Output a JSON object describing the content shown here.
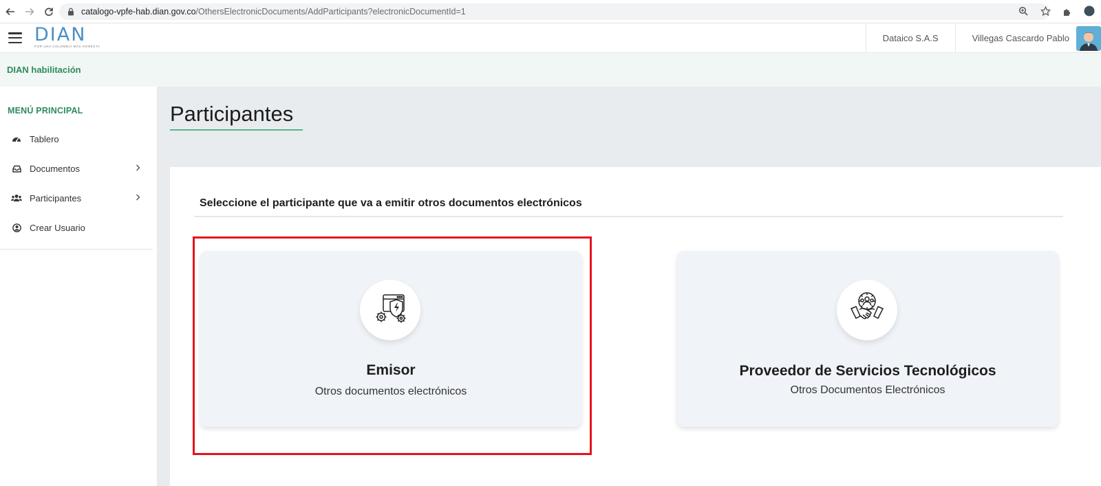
{
  "browser": {
    "url_host": "catalogo-vpfe-hab.dian.gov.co",
    "url_path": "/OthersElectronicDocuments/AddParticipants?electronicDocumentId=1",
    "icons": [
      "back-arrow-icon",
      "forward-arrow-icon",
      "reload-icon",
      "lock-icon",
      "zoom-icon",
      "star-icon",
      "extensions-icon"
    ]
  },
  "header": {
    "logo_text": "DIAN",
    "logo_tagline": "POR UNA COLOMBIA MÁS HONESTA",
    "company": "Dataico S.A.S",
    "user": "Villegas Cascardo Pablo"
  },
  "env": {
    "title": "DIAN habilitación"
  },
  "sidebar": {
    "title": "MENÚ PRINCIPAL",
    "items": [
      {
        "label": "Tablero",
        "icon": "dashboard-icon",
        "has_submenu": false
      },
      {
        "label": "Documentos",
        "icon": "inbox-icon",
        "has_submenu": true
      },
      {
        "label": "Participantes",
        "icon": "users-icon",
        "has_submenu": true
      },
      {
        "label": "Crear Usuario",
        "icon": "user-circle-icon",
        "has_submenu": false
      }
    ]
  },
  "main": {
    "title": "Participantes",
    "heading": "Seleccione el participante que va a emitir otros documentos electrónicos",
    "cards": [
      {
        "title": "Emisor",
        "subtitle": "Otros documentos electrónicos",
        "icon": "shield-gears-icon",
        "highlighted": true
      },
      {
        "title": "Proveedor de Servicios Tecnológicos",
        "subtitle": "Otros Documentos Electrónicos",
        "icon": "handshake-team-icon",
        "highlighted": false
      }
    ]
  },
  "colors": {
    "accent_green": "#2e8a5e",
    "underline_green": "#55b48c",
    "highlight_red": "#e4141b",
    "logo_blue": "#4a8fc6"
  }
}
